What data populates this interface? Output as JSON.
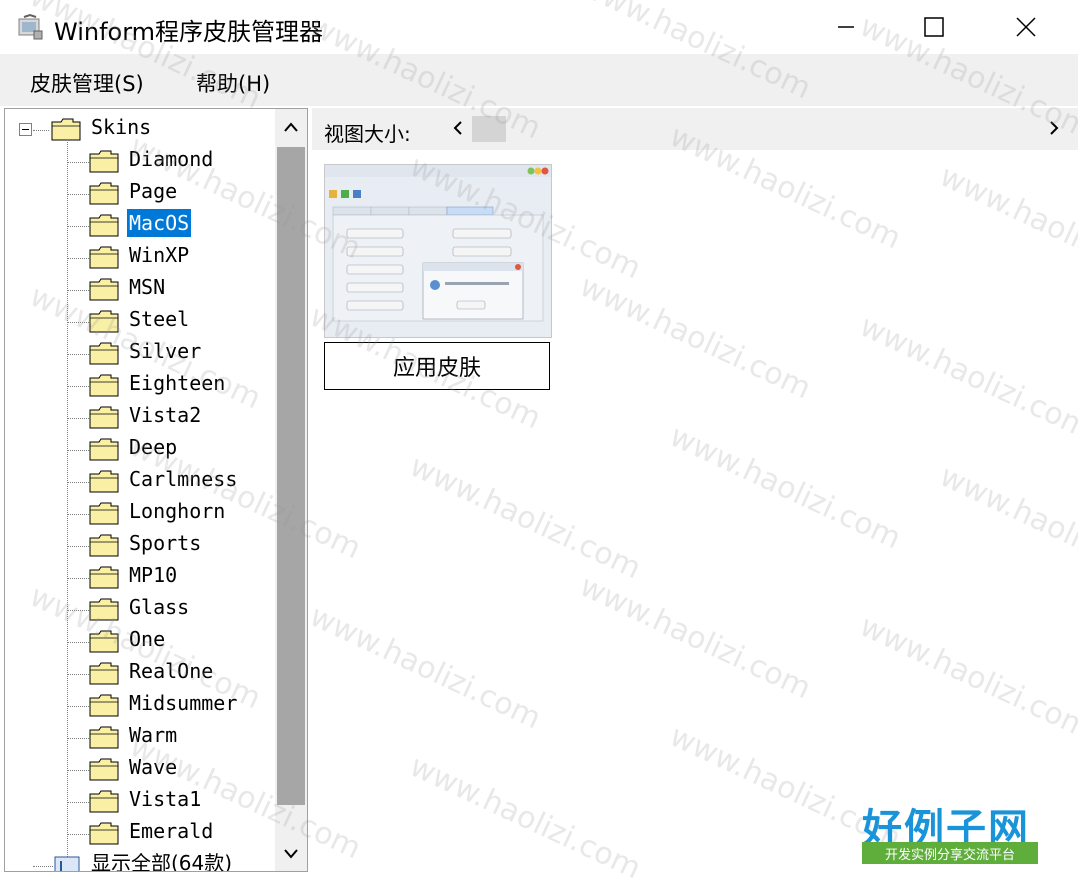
{
  "window": {
    "title": "Winform程序皮肤管理器"
  },
  "menu": {
    "skin_label": "皮肤管理(S)",
    "help_label": "帮助(H)"
  },
  "tree": {
    "root_label": "Skins",
    "items": [
      {
        "label": "Diamond"
      },
      {
        "label": "Page"
      },
      {
        "label": "MacOS",
        "selected": true
      },
      {
        "label": "WinXP"
      },
      {
        "label": "MSN"
      },
      {
        "label": "Steel"
      },
      {
        "label": "Silver"
      },
      {
        "label": "Eighteen"
      },
      {
        "label": "Vista2"
      },
      {
        "label": "Deep"
      },
      {
        "label": "Carlmness"
      },
      {
        "label": "Longhorn"
      },
      {
        "label": "Sports"
      },
      {
        "label": "MP10"
      },
      {
        "label": "Glass"
      },
      {
        "label": "One"
      },
      {
        "label": "RealOne"
      },
      {
        "label": "Midsummer"
      },
      {
        "label": "Warm"
      },
      {
        "label": "Wave"
      },
      {
        "label": "Vista1"
      },
      {
        "label": "Emerald"
      }
    ],
    "bottom_label": "显示全部(64款)"
  },
  "view": {
    "size_label": "视图大小:"
  },
  "preview": {
    "icon": "skin-preview-image"
  },
  "apply_button": {
    "label": "应用皮肤"
  },
  "watermark": {
    "text": "www.haolizi.com"
  },
  "logo": {
    "main": "好例子网",
    "sub": "开发实例分享交流平台"
  },
  "colors": {
    "selection": "#0078d7",
    "folder": "#f9f0a6",
    "logo_blue": "#1a94d9",
    "logo_green": "#5fae3c"
  }
}
